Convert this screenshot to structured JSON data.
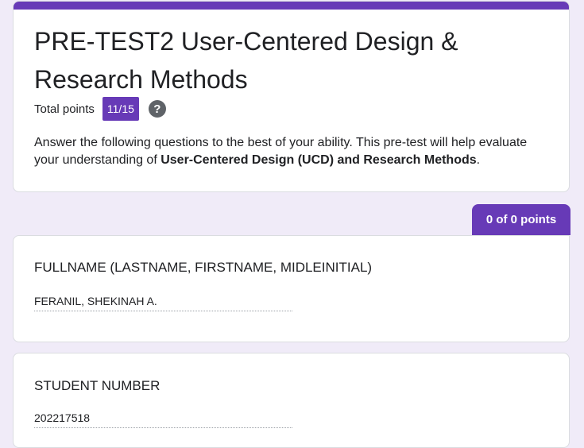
{
  "form": {
    "title": "PRE-TEST2 User-Centered Design & Research Methods",
    "total_points_label": "Total points",
    "score": "11/15",
    "help_icon": "help-circle-icon",
    "description_intro": " Answer the following questions to the best of your ability. This pre-test will help evaluate your understanding of ",
    "description_bold": "User-Centered Design (UCD) and Research Methods",
    "description_end": ".",
    "accent_color": "#673ab7",
    "background_color": "#f0ebf8"
  },
  "section": {
    "points": "0 of 0 points"
  },
  "questions": [
    {
      "title": "FULLNAME (LASTNAME, FIRSTNAME, MIDLEINITIAL)",
      "answer": "FERANIL, SHEKINAH A."
    },
    {
      "title": "STUDENT NUMBER",
      "answer": "202217518"
    }
  ]
}
